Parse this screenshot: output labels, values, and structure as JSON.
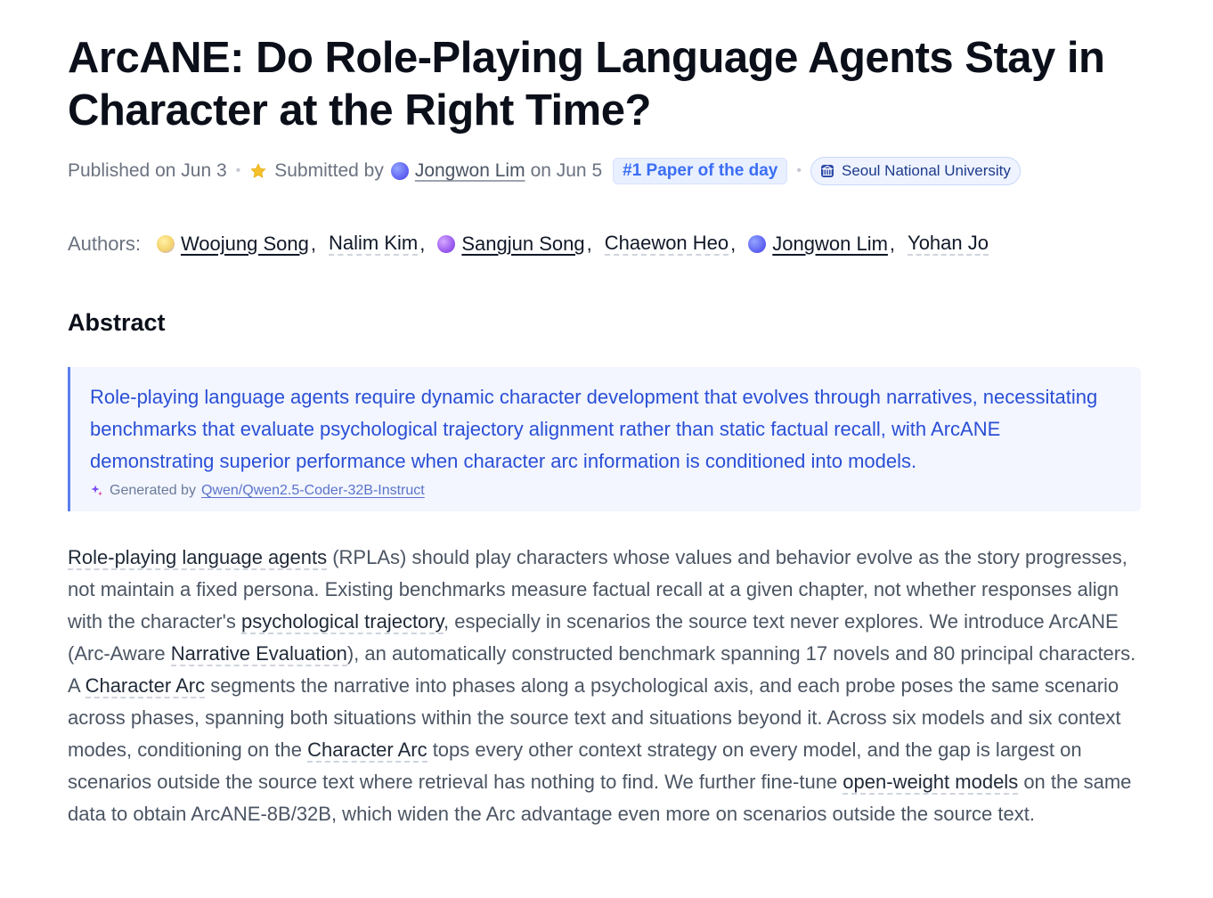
{
  "paper": {
    "title": "ArcANE: Do Role-Playing Language Agents Stay in Character at the Right Time?",
    "published": "Published on Jun 3",
    "submitted_prefix": "Submitted by",
    "submitter": "Jongwon Lim",
    "submitted_date": "on Jun 5",
    "badge": "#1 Paper of the day",
    "organization": "Seoul National University"
  },
  "authors": {
    "label": "Authors:",
    "list": [
      {
        "name": "Woojung Song",
        "avatar": "yellow"
      },
      {
        "name": "Nalim Kim",
        "avatar": ""
      },
      {
        "name": "Sangjun Song",
        "avatar": "purple"
      },
      {
        "name": "Chaewon Heo",
        "avatar": ""
      },
      {
        "name": "Jongwon Lim",
        "avatar": "blue"
      },
      {
        "name": "Yohan Jo",
        "avatar": ""
      }
    ]
  },
  "abstract": {
    "heading": "Abstract",
    "ai_summary": "Role-playing language agents require dynamic character development that evolves through narratives, necessitating benchmarks that evaluate psychological trajectory alignment rather than static factual recall, with ArcANE demonstrating superior performance when character arc information is conditioned into models.",
    "generated_by_label": "Generated by",
    "generated_by_model": "Qwen/Qwen2.5-Coder-32B-Instruct",
    "segments": [
      {
        "t": "Role-playing language agents",
        "term": true
      },
      {
        "t": " (RPLAs) should play characters whose values and behavior evolve as the story progresses, not maintain a fixed persona. Existing benchmarks measure factual recall at a given chapter, not whether responses align with the character's ",
        "term": false
      },
      {
        "t": "psychological trajectory",
        "term": true
      },
      {
        "t": ", especially in scenarios the source text never explores. We introduce ArcANE (Arc-Aware ",
        "term": false
      },
      {
        "t": "Narrative Evaluation",
        "term": true
      },
      {
        "t": "), an automatically constructed benchmark spanning 17 novels and 80 principal characters. A ",
        "term": false
      },
      {
        "t": "Character Arc",
        "term": true
      },
      {
        "t": " segments the narrative into phases along a psychological axis, and each probe poses the same scenario across phases, spanning both situations within the source text and situations beyond it. Across six models and six context modes, conditioning on the ",
        "term": false
      },
      {
        "t": "Character Arc",
        "term": true
      },
      {
        "t": " tops every other context strategy on every model, and the gap is largest on scenarios outside the source text where retrieval has nothing to find. We further fine-tune ",
        "term": false
      },
      {
        "t": "open-weight models",
        "term": true
      },
      {
        "t": " on the same data to obtain ArcANE-8B/32B, which widen the Arc advantage even more on scenarios outside the source text.",
        "term": false
      }
    ]
  },
  "colors": {
    "summary_text": "#2a4fd6",
    "summary_bg": "#f3f6ff",
    "badge": "#3b6ef5"
  }
}
